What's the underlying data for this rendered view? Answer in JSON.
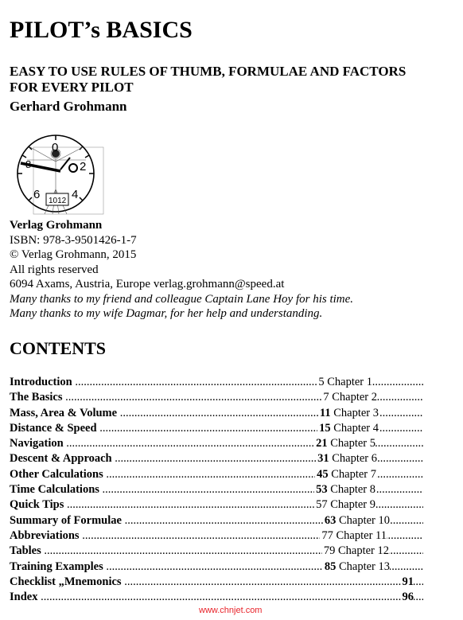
{
  "title": "PILOT’s BASICS",
  "subtitle_line1": "EASY TO USE RULES OF THUMB, FORMULAE AND FACTORS",
  "subtitle_line2": "FOR EVERY PILOT",
  "author": "Gerhard Grohmann",
  "logo": {
    "icon": "altimeter-vitruvian-man-icon",
    "dial_numbers": [
      "0",
      "8",
      "2",
      "6",
      "4"
    ],
    "pressure_window": "1012"
  },
  "publisher": {
    "name": "Verlag Grohmann",
    "isbn": "ISBN: 978-3-9501426-1-7",
    "copyright": "© Verlag Grohmann, 2015",
    "rights": "All rights reserved",
    "address": "6094 Axams, Austria, Europe verlag.grohmann@speed.at",
    "thanks1": "Many thanks to my friend and colleague Captain Lane Hoy for his time.",
    "thanks2": "Many thanks to my wife Dagmar, for her help and understanding."
  },
  "contents_heading": "CONTENTS",
  "toc": [
    {
      "label": "Introduction",
      "page": "5",
      "page_bold": false,
      "chapter": "Chapter 1"
    },
    {
      "label": "The Basics",
      "page": "7",
      "page_bold": false,
      "chapter": "Chapter 2"
    },
    {
      "label": "Mass, Area & Volume",
      "page": "11",
      "page_bold": true,
      "chapter": "Chapter 3"
    },
    {
      "label": "Distance & Speed",
      "page": "15",
      "page_bold": true,
      "chapter": "Chapter 4"
    },
    {
      "label": "Navigation",
      "page": "21",
      "page_bold": true,
      "chapter": "Chapter 5"
    },
    {
      "label": "Descent & Approach",
      "page": "31",
      "page_bold": true,
      "chapter": "Chapter 6"
    },
    {
      "label": "Other Calculations",
      "page": "45",
      "page_bold": true,
      "chapter": "Chapter 7"
    },
    {
      "label": "Time Calculations",
      "page": "53",
      "page_bold": true,
      "chapter": "Chapter 8"
    },
    {
      "label": "Quick Tips",
      "page": "57",
      "page_bold": false,
      "chapter": "Chapter 9"
    },
    {
      "label": "Summary of Formulae",
      "page": "63",
      "page_bold": true,
      "chapter": "Chapter 10"
    },
    {
      "label": "Abbreviations",
      "page": "77",
      "page_bold": false,
      "chapter": "Chapter 11"
    },
    {
      "label": "Tables",
      "page": "79",
      "page_bold": false,
      "chapter": "Chapter 12"
    },
    {
      "label": "Training Examples",
      "page": "85",
      "page_bold": true,
      "chapter": "Chapter 13"
    },
    {
      "label": "Checklist „Mnemonics",
      "page": "91",
      "page_bold": true,
      "chapter": ""
    },
    {
      "label": "Index",
      "page": "96",
      "page_bold": true,
      "chapter": ""
    }
  ],
  "watermark": "www.chnjet.com"
}
